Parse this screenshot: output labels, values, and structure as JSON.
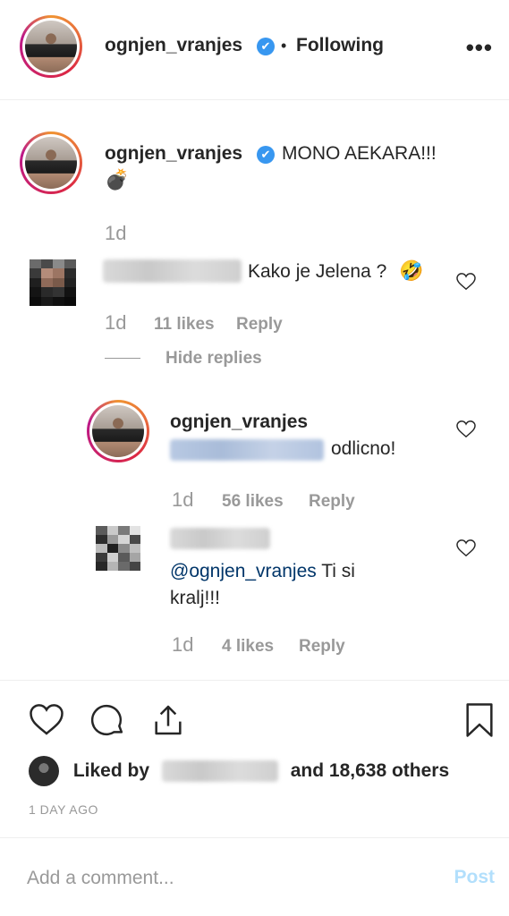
{
  "header": {
    "username": "ognjen_vranjes",
    "verified_glyph": "✔",
    "separator": "•",
    "follow_status": "Following",
    "more_label": "•••"
  },
  "caption": {
    "username": "ognjen_vranjes",
    "text": "MONO AEKARA!!!",
    "emoji": "💣",
    "time": "1d"
  },
  "comments": [
    {
      "text": "Kako je Jelena ?",
      "emoji": "🤣",
      "time": "1d",
      "likes": "11 likes",
      "reply": "Reply",
      "hide_replies": "Hide replies"
    }
  ],
  "replies": [
    {
      "username": "ognjen_vranjes",
      "text": "odlicno!",
      "time": "1d",
      "likes": "56 likes",
      "reply": "Reply"
    },
    {
      "mention": "@ognjen_vranjes",
      "text_line1": " Ti si",
      "text_line2": "kralj!!!",
      "time": "1d",
      "likes": "4 likes",
      "reply": "Reply"
    }
  ],
  "post_actions": {
    "icons": [
      "heart-icon",
      "comment-icon",
      "share-icon",
      "bookmark-icon"
    ],
    "liked_by_prefix": "Liked by",
    "liked_by_suffix": "and 18,638 others",
    "time_ago": "1 DAY AGO"
  },
  "add_comment": {
    "placeholder": "Add a comment...",
    "post_label": "Post"
  },
  "colors": {
    "verified": "#3897f0",
    "text": "#262626",
    "muted": "#999999",
    "post_disabled": "#b2dffc",
    "mention": "#003569"
  }
}
